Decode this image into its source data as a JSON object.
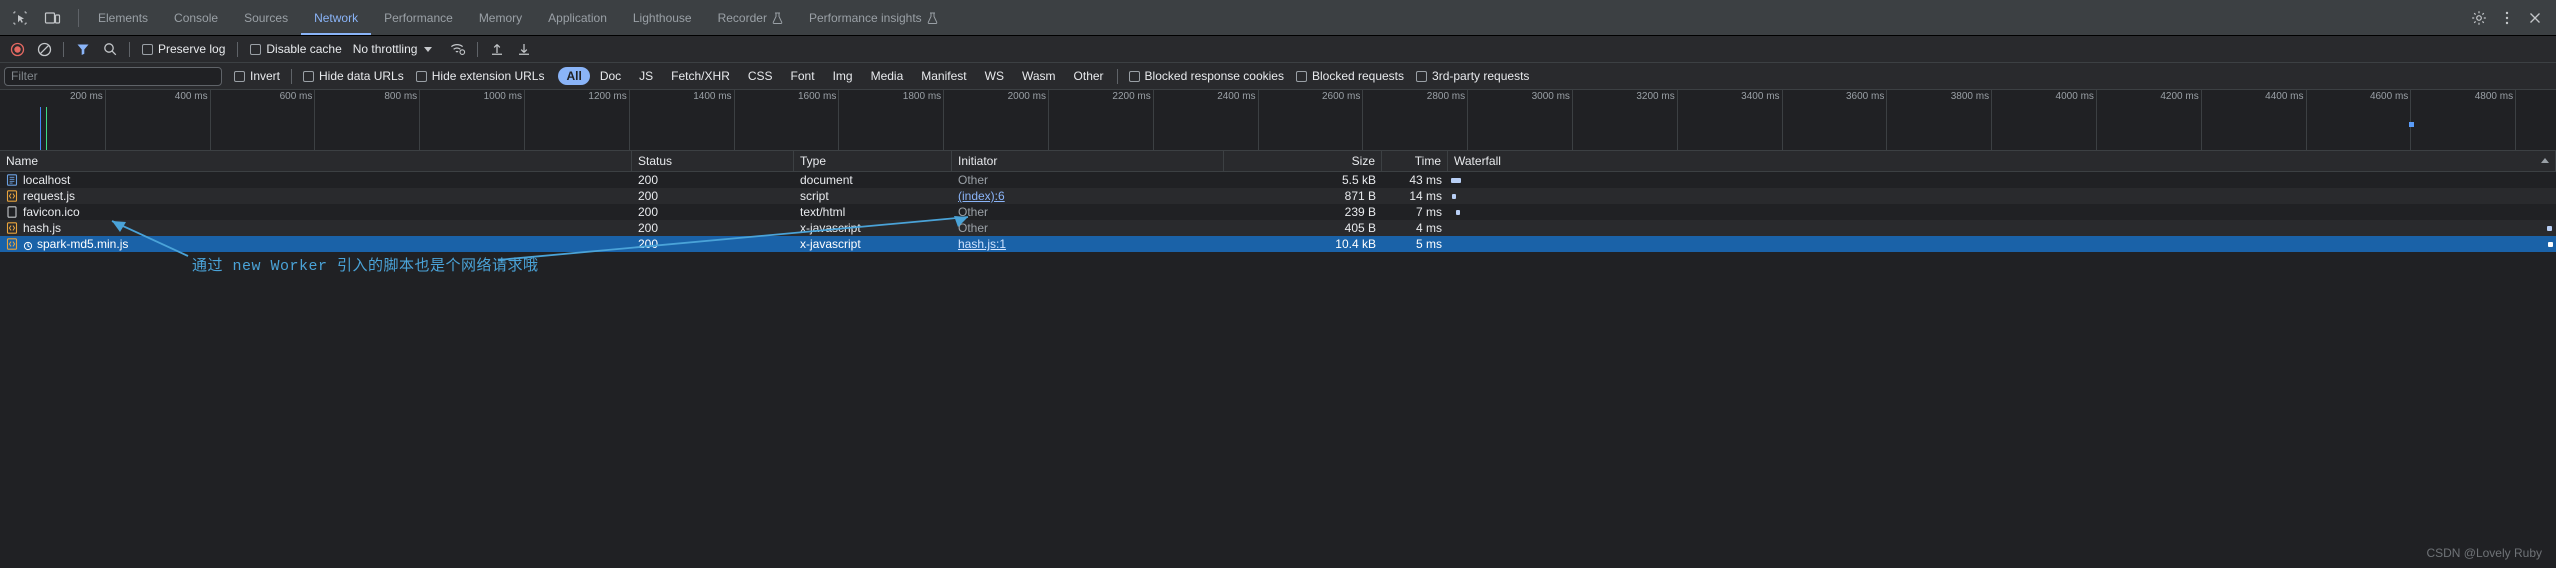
{
  "tabbar": {
    "left_icons": [
      {
        "name": "inspect-element-icon",
        "title": "Inspect"
      },
      {
        "name": "device-toolbar-icon",
        "title": "Toggle device toolbar"
      }
    ],
    "tabs": [
      {
        "label": "Elements",
        "active": false,
        "icon": null
      },
      {
        "label": "Console",
        "active": false,
        "icon": null
      },
      {
        "label": "Sources",
        "active": false,
        "icon": null
      },
      {
        "label": "Network",
        "active": true,
        "icon": null
      },
      {
        "label": "Performance",
        "active": false,
        "icon": null
      },
      {
        "label": "Memory",
        "active": false,
        "icon": null
      },
      {
        "label": "Application",
        "active": false,
        "icon": null
      },
      {
        "label": "Lighthouse",
        "active": false,
        "icon": null
      },
      {
        "label": "Recorder",
        "active": false,
        "icon": "beaker-icon"
      },
      {
        "label": "Performance insights",
        "active": false,
        "icon": "beaker-icon"
      }
    ],
    "right_icons": [
      {
        "name": "settings-gear-icon"
      },
      {
        "name": "more-options-icon"
      },
      {
        "name": "close-icon"
      }
    ]
  },
  "toolbar": {
    "record_button": {
      "name": "record-stop-button",
      "color": "#e46962"
    },
    "clear_button": {
      "name": "clear-button"
    },
    "filter_button": {
      "name": "filter-funnel-icon",
      "color": "#8ab4f8"
    },
    "search_button": {
      "name": "search-icon"
    },
    "preserve_log": {
      "label": "Preserve log",
      "checked": false
    },
    "disable_cache": {
      "label": "Disable cache",
      "checked": false
    },
    "throttling": {
      "value": "No throttling"
    },
    "wifi_icon": "network-conditions-icon",
    "import_icon": "import-har-icon",
    "export_icon": "export-har-icon"
  },
  "filterbar": {
    "filter_placeholder": "Filter",
    "filter_value": "",
    "invert": {
      "label": "Invert",
      "checked": false
    },
    "hide_data_urls": {
      "label": "Hide data URLs",
      "checked": false
    },
    "hide_extension_urls": {
      "label": "Hide extension URLs",
      "checked": false
    },
    "type_chips": [
      {
        "label": "All",
        "active": true
      },
      {
        "label": "Doc",
        "active": false
      },
      {
        "label": "JS",
        "active": false
      },
      {
        "label": "Fetch/XHR",
        "active": false
      },
      {
        "label": "CSS",
        "active": false
      },
      {
        "label": "Font",
        "active": false
      },
      {
        "label": "Img",
        "active": false
      },
      {
        "label": "Media",
        "active": false
      },
      {
        "label": "Manifest",
        "active": false
      },
      {
        "label": "WS",
        "active": false
      },
      {
        "label": "Wasm",
        "active": false
      },
      {
        "label": "Other",
        "active": false
      }
    ],
    "blocked_response_cookies": {
      "label": "Blocked response cookies",
      "checked": false
    },
    "blocked_requests": {
      "label": "Blocked requests",
      "checked": false
    },
    "third_party_requests": {
      "label": "3rd-party requests",
      "checked": false
    }
  },
  "overview": {
    "ticks": [
      "200 ms",
      "400 ms",
      "600 ms",
      "800 ms",
      "1000 ms",
      "1200 ms",
      "1400 ms",
      "1600 ms",
      "1800 ms",
      "2000 ms",
      "2200 ms",
      "2400 ms",
      "2600 ms",
      "2800 ms",
      "3000 ms",
      "3200 ms",
      "3400 ms",
      "3600 ms",
      "3800 ms",
      "4000 ms",
      "4200 ms",
      "4400 ms",
      "4600 ms",
      "4800 ms"
    ],
    "event_markers": [
      {
        "name": "dom-content-loaded-marker",
        "color": "#4287f5",
        "x_percent": 1.6
      },
      {
        "name": "load-event-marker",
        "color": "#3ddc84",
        "x_percent": 1.75
      },
      {
        "name": "request-marker",
        "color": "#5a9cf8",
        "x_percent": 94.3
      }
    ]
  },
  "table": {
    "columns": [
      {
        "key": "name",
        "label": "Name"
      },
      {
        "key": "status",
        "label": "Status"
      },
      {
        "key": "type",
        "label": "Type"
      },
      {
        "key": "initiator",
        "label": "Initiator"
      },
      {
        "key": "size",
        "label": "Size"
      },
      {
        "key": "time",
        "label": "Time"
      },
      {
        "key": "waterfall",
        "label": "Waterfall"
      }
    ],
    "rows": [
      {
        "name": "localhost",
        "icon": "document-file-icon",
        "icon_color": "#6ba0e0",
        "status": "200",
        "type": "document",
        "initiator": "Other",
        "initiator_link": false,
        "size": "5.5 kB",
        "time": "43 ms",
        "selected": false,
        "worker": false,
        "wf_left_pct": 0.4,
        "wf_width_pct": 0.9,
        "wf_color": "#8ab4f8"
      },
      {
        "name": "request.js",
        "icon": "script-file-icon",
        "icon_color": "#e8a33d",
        "status": "200",
        "type": "script",
        "initiator": "(index):6",
        "initiator_link": true,
        "size": "871 B",
        "time": "14 ms",
        "selected": false,
        "worker": false,
        "wf_left_pct": 0.5,
        "wf_width_pct": 0.35,
        "wf_color": "#8ab4f8"
      },
      {
        "name": "favicon.ico",
        "icon": "generic-file-icon",
        "icon_color": "#c4c7ca",
        "status": "200",
        "type": "text/html",
        "initiator": "Other",
        "initiator_link": false,
        "size": "239 B",
        "time": "7 ms",
        "selected": false,
        "worker": false,
        "wf_left_pct": 0.85,
        "wf_width_pct": 0.25,
        "wf_color": "#8ab4f8"
      },
      {
        "name": "hash.js",
        "icon": "script-file-icon",
        "icon_color": "#e8a33d",
        "status": "200",
        "type": "x-javascript",
        "initiator": "Other",
        "initiator_link": false,
        "size": "405 B",
        "time": "4 ms",
        "selected": false,
        "worker": false,
        "wf_left_pct": 99.4,
        "wf_width_pct": 0.3,
        "wf_color": "#8ab4f8"
      },
      {
        "name": "spark-md5.min.js",
        "icon": "script-file-icon",
        "icon_color": "#e8a33d",
        "status": "200",
        "type": "x-javascript",
        "initiator": "hash.js:1",
        "initiator_link": true,
        "size": "10.4 kB",
        "time": "5 ms",
        "selected": true,
        "worker": true,
        "wf_left_pct": 99.5,
        "wf_width_pct": 0.3,
        "wf_color": "#ffffff"
      }
    ]
  },
  "annotation": {
    "text": "通过 new Worker 引入的脚本也是个网络请求哦",
    "color": "#4aa3d8"
  },
  "watermark": "CSDN @Lovely Ruby"
}
